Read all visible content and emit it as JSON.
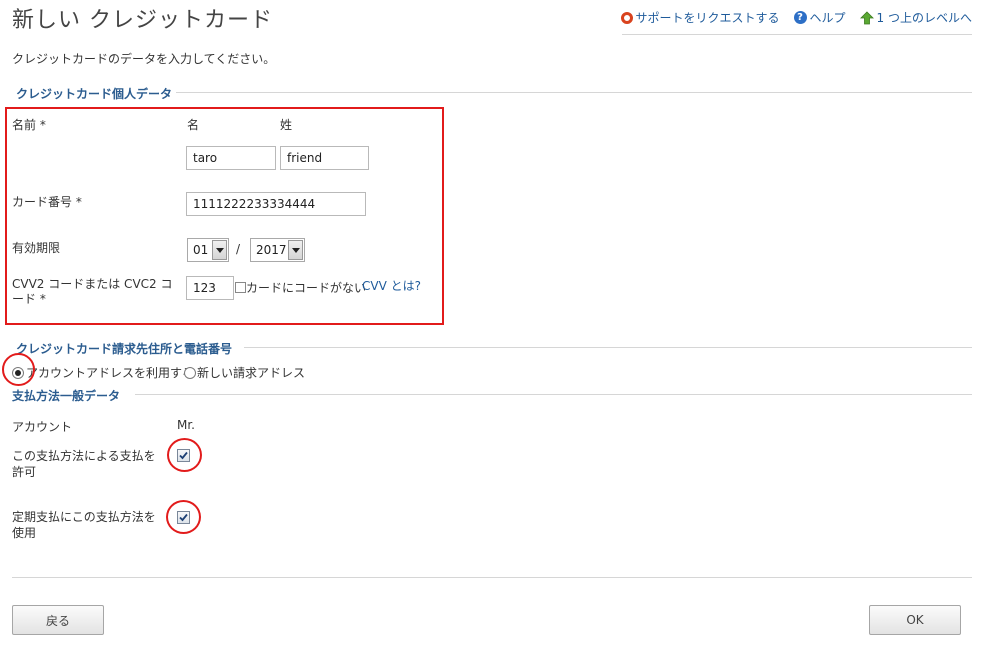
{
  "page": {
    "title": "新しい クレジットカード",
    "intro": "クレジットカードのデータを入力してください。"
  },
  "toplinks": {
    "support": "サポートをリクエストする",
    "help": "ヘルプ",
    "up": "1 つ上のレベルへ"
  },
  "personal": {
    "section_title": "クレジットカード個人データ",
    "name_label": "名前 *",
    "first_label": "名",
    "last_label": "姓",
    "first_value": "taro",
    "last_value": "friend",
    "card_label": "カード番号 *",
    "card_value": "1111222233334444",
    "expiry_label": "有効期限",
    "expiry_month": "01",
    "expiry_sep": "/",
    "expiry_year": "2017",
    "cvv_label": "CVV2 コードまたは CVC2 コード *",
    "cvv_value": "123",
    "no_code_label": "カードにコードがない",
    "cvv_link": "CVV とは?"
  },
  "billing": {
    "section_title": "クレジットカード請求先住所と電話番号",
    "option_account": "アカウントアドレスを利用する",
    "option_new": "新しい請求アドレス",
    "selected": "account"
  },
  "general": {
    "section_title": "支払方法一般データ",
    "account_label": "アカウント",
    "account_value": "Mr.",
    "allow_label": "この支払方法による支払を許可",
    "allow_checked": true,
    "recurring_label": "定期支払にこの支払方法を使用",
    "recurring_checked": true
  },
  "footer": {
    "back": "戻る",
    "ok": "OK"
  }
}
